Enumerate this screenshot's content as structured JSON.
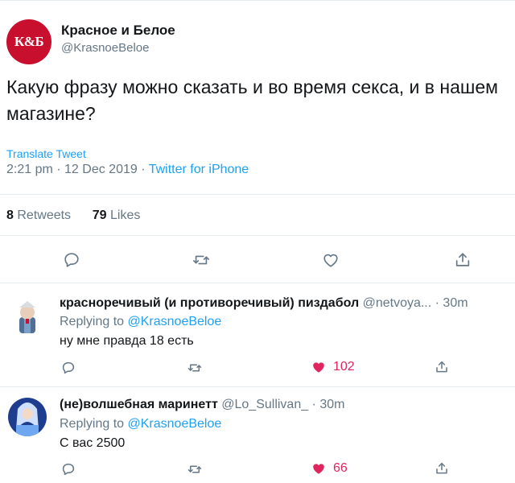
{
  "tweet": {
    "avatar_text": "К&Б",
    "author_name": "Красное и Белое",
    "author_handle": "@KrasnoeBeloe",
    "text": "Какую фразу можно сказать и во время секса, и в нашем магазине?",
    "translate_label": "Translate Tweet",
    "time": "2:21 pm",
    "date": "12 Dec 2019",
    "separator": " · ",
    "source": "Twitter for iPhone",
    "retweets_count": "8",
    "retweets_label": "Retweets",
    "likes_count": "79",
    "likes_label": "Likes"
  },
  "replies": [
    {
      "name": "красноречивый (и противоречивый) пиздабол",
      "handle": "@netvoya...",
      "time": "· 30m",
      "replying_prefix": "Replying to",
      "replying_to": "@KrasnoeBeloe",
      "text": "ну мне правда 18 есть",
      "likes": "102"
    },
    {
      "name": "(не)волшебная маринетт",
      "handle": "@Lo_Sullivan_",
      "time": "· 30m",
      "replying_prefix": "Replying to",
      "replying_to": "@KrasnoeBeloe",
      "text": "С вас 2500",
      "likes": "66"
    }
  ],
  "icons": [
    "reply-icon",
    "retweet-icon",
    "like-icon",
    "share-icon"
  ],
  "colors": {
    "brand_red": "#c8102e",
    "link_blue": "#1da1f2",
    "muted_gray": "#657786",
    "like_pink": "#e0245e"
  }
}
